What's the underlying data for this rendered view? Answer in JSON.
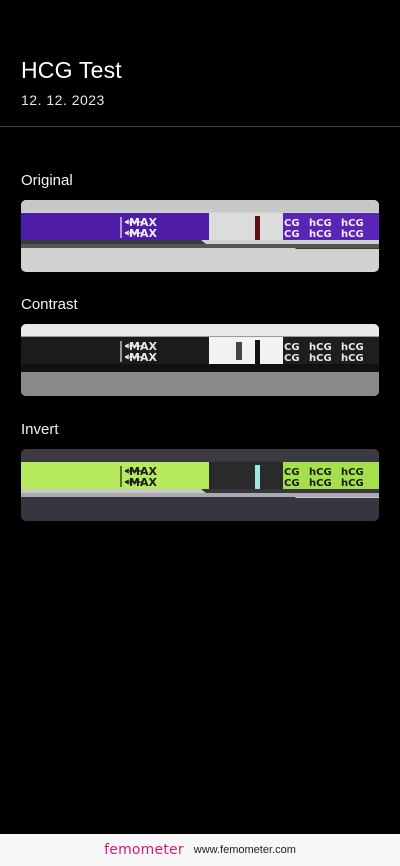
{
  "header": {
    "title": "HCG Test",
    "date": "12. 12. 2023"
  },
  "sections": [
    {
      "label": "Original",
      "variant": "original"
    },
    {
      "label": "Contrast",
      "variant": "contrast"
    },
    {
      "label": "Invert",
      "variant": "invert"
    }
  ],
  "strip_text": {
    "max": "MAX",
    "hcg": "hCG",
    "cg": "CG"
  },
  "footer": {
    "brand": "femometer",
    "url": "www.femometer.com"
  },
  "colors": {
    "background": "#000000",
    "brand": "#d01c7d",
    "original_band": "#5a1fb0",
    "invert_band": "#b5ea5c"
  }
}
